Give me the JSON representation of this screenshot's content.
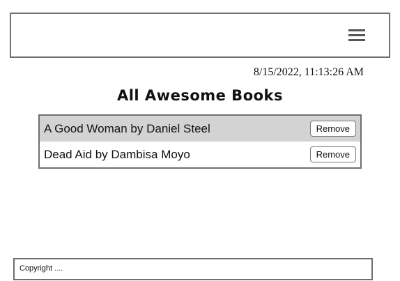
{
  "header": {
    "menu_icon": "hamburger-menu-icon"
  },
  "timestamp": "8/15/2022, 11:13:26 AM",
  "main": {
    "title": "All Awesome Books",
    "books": [
      {
        "label": "A Good Woman by Daniel Steel",
        "remove_label": "Remove"
      },
      {
        "label": "Dead Aid by Dambisa Moyo",
        "remove_label": "Remove"
      }
    ]
  },
  "footer": {
    "text": "Copyright ...."
  },
  "colors": {
    "border": "#6f6f6f",
    "row_shade": "#d3d3d3"
  }
}
